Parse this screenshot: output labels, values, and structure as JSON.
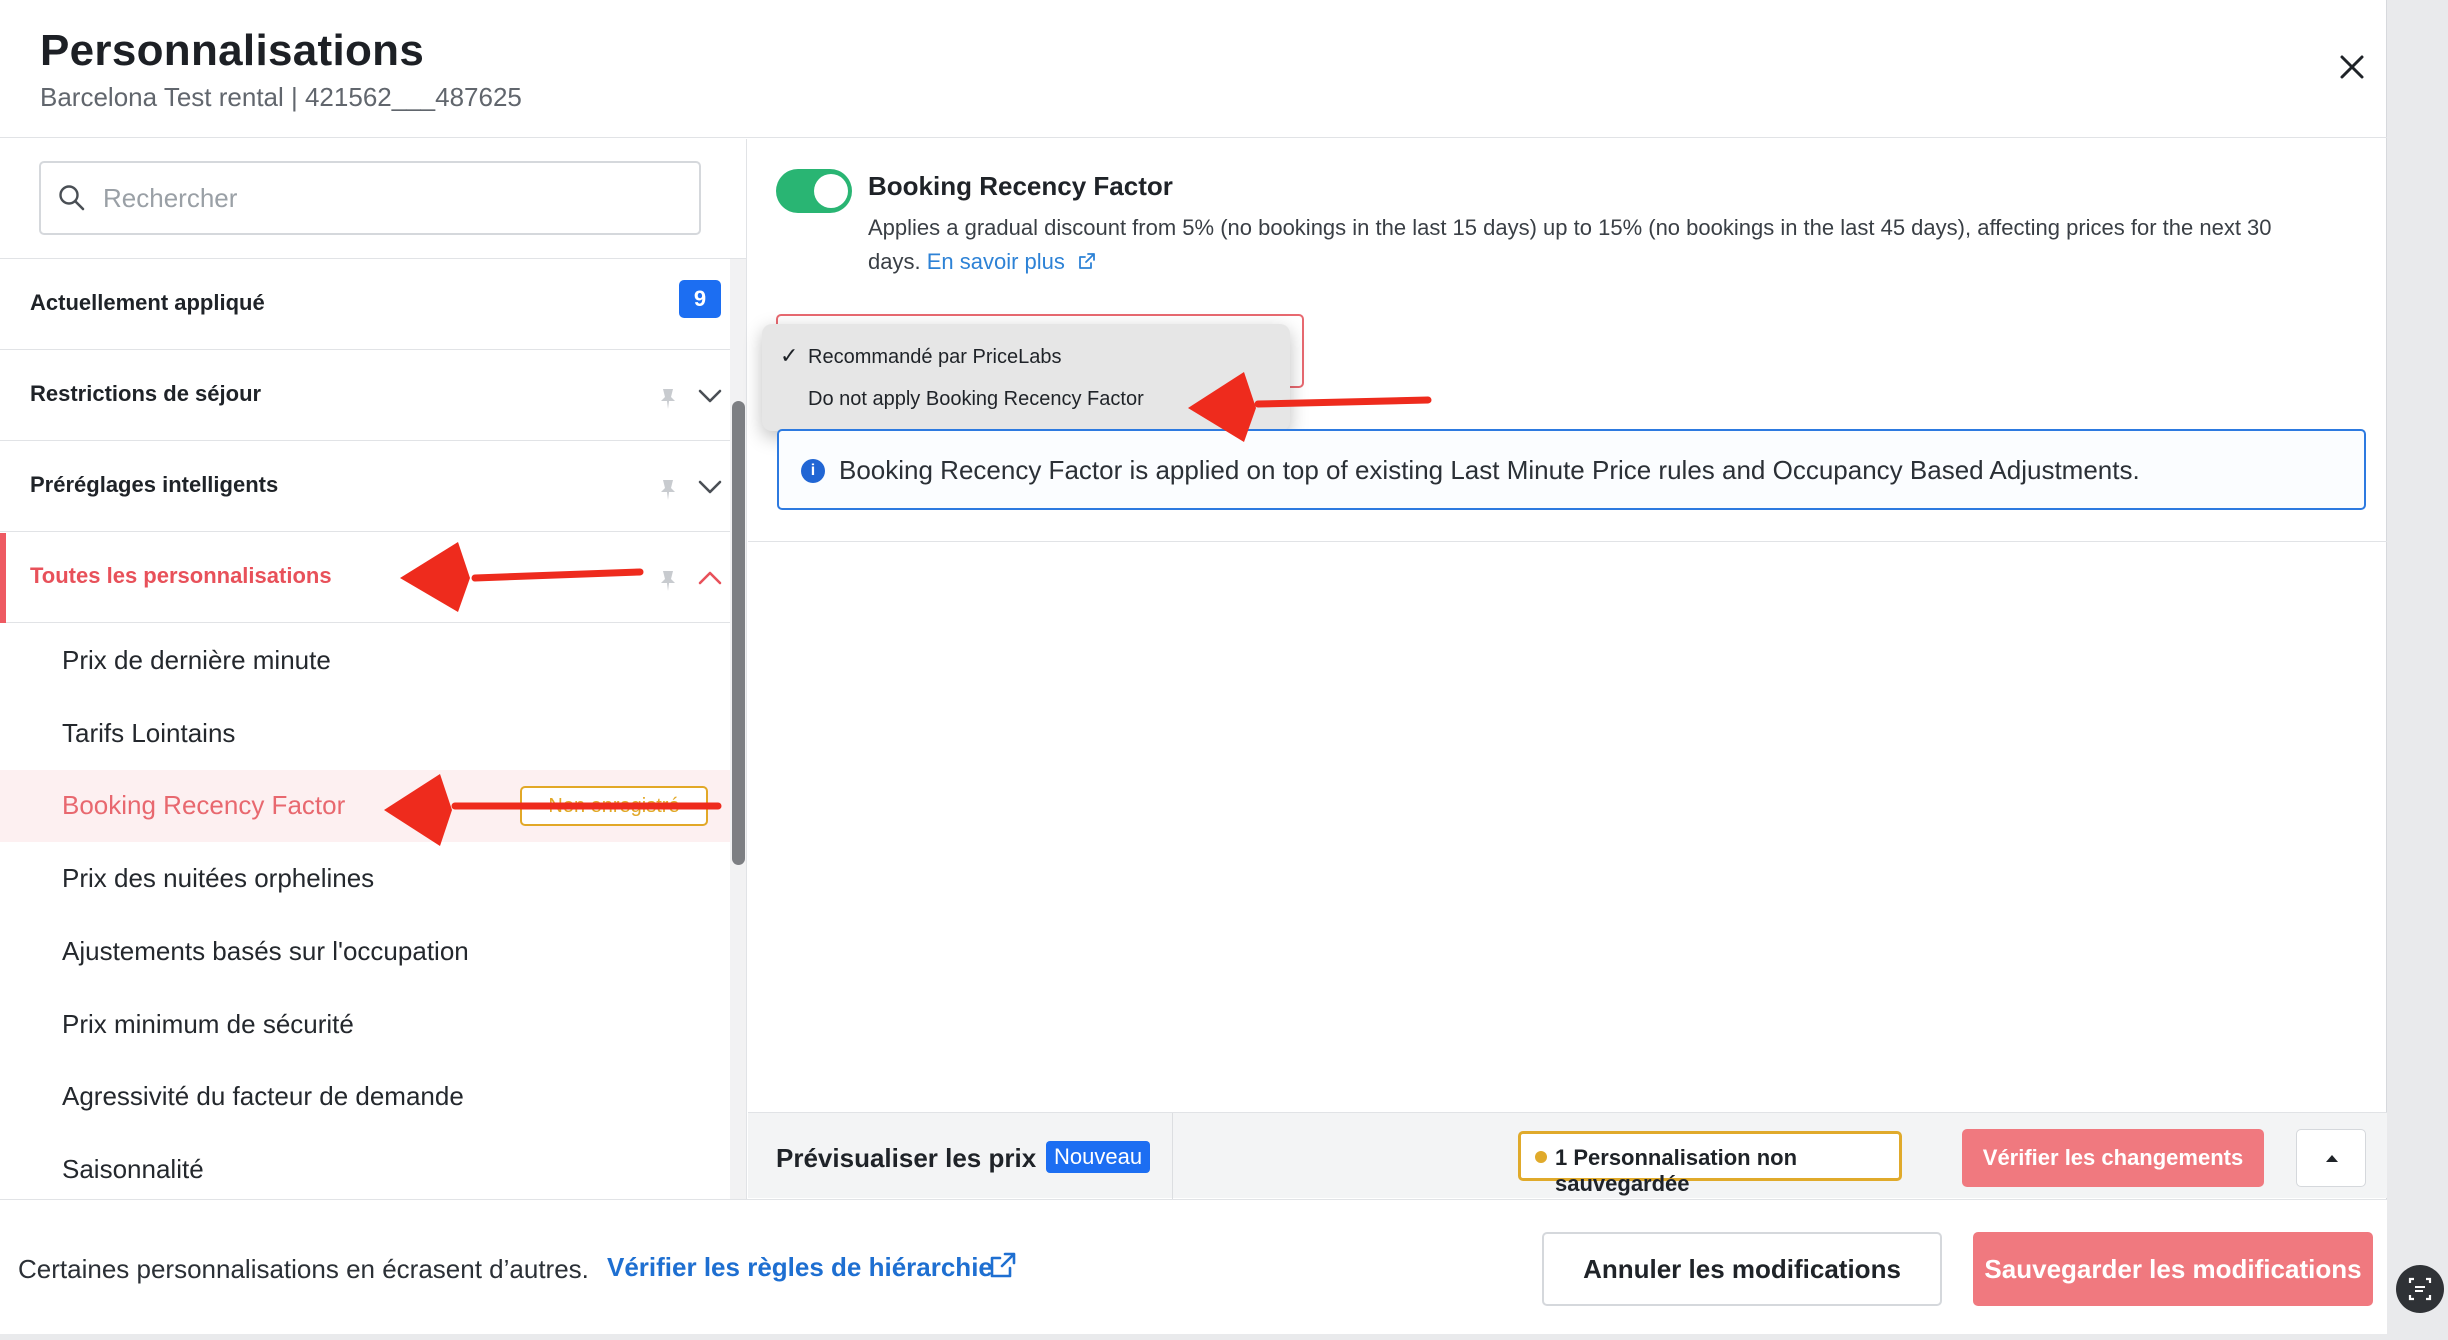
{
  "header": {
    "title": "Personnalisations",
    "subtitle": "Barcelona Test rental | 421562___487625"
  },
  "sidebar": {
    "search_placeholder": "Rechercher",
    "sections": [
      {
        "label": "Actuellement appliqué",
        "badge": "9"
      },
      {
        "label": "Restrictions de séjour"
      },
      {
        "label": "Préréglages intelligents"
      },
      {
        "label": "Toutes les personnalisations"
      }
    ],
    "items": [
      {
        "label": "Prix de dernière minute"
      },
      {
        "label": "Tarifs Lointains"
      },
      {
        "label": "Booking Recency Factor",
        "tag": "Non enregistré"
      },
      {
        "label": "Prix des nuitées orphelines"
      },
      {
        "label": "Ajustements basés sur l'occupation"
      },
      {
        "label": "Prix minimum de sécurité"
      },
      {
        "label": "Agressivité du facteur de demande"
      },
      {
        "label": "Saisonnalité"
      }
    ]
  },
  "content": {
    "title": "Booking Recency Factor",
    "description": "Applies a gradual discount from 5% (no bookings in the last 15 days) up to 15% (no bookings in the last 45 days), affecting prices for the next 30 days.",
    "learn_more": "En savoir plus",
    "dropdown": {
      "options": [
        {
          "label": "Recommandé par PriceLabs",
          "checked": true
        },
        {
          "label": "Do not apply Booking Recency Factor",
          "checked": false
        }
      ]
    },
    "info": "Booking Recency Factor is applied on top of existing Last Minute Price rules and Occupancy Based Adjustments."
  },
  "preview_bar": {
    "label": "Prévisualiser les prix",
    "badge": "Nouveau",
    "unsaved": "1 Personnalisation non sauvegardée",
    "verify": "Vérifier les changements"
  },
  "footer": {
    "note": "Certaines personnalisations en écrasent d’autres.",
    "link": "Vérifier les règles de hiérarchie",
    "cancel": "Annuler les modifications",
    "save": "Sauvegarder les modifications"
  },
  "colors": {
    "accent": "#f0797f",
    "primary": "#1c6ef2",
    "toggle_on": "#29b573",
    "warning": "#e0aa2b",
    "annotation_arrow": "#ee2b1d"
  }
}
